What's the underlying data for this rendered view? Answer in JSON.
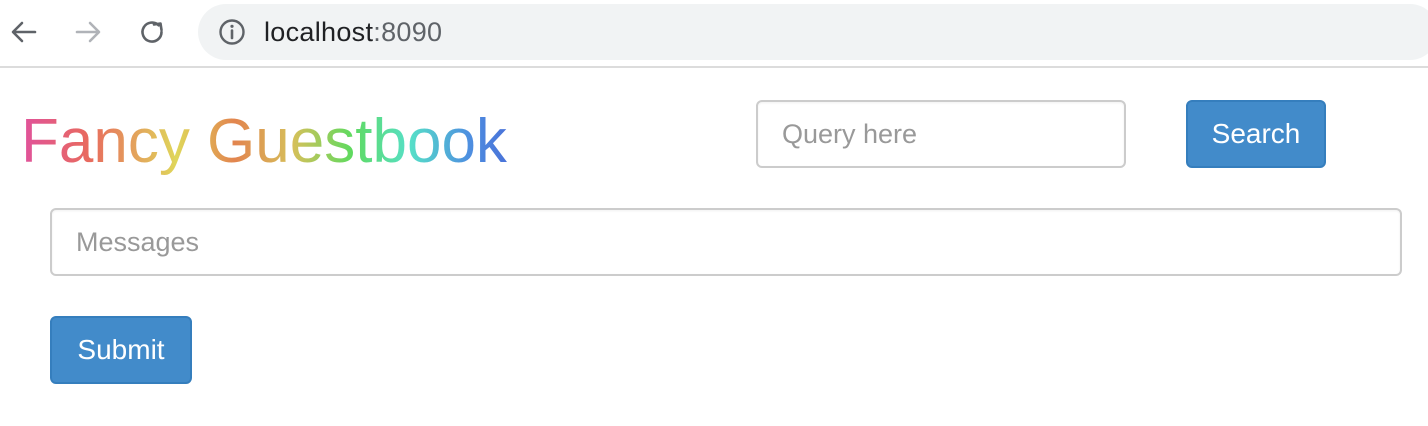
{
  "browser": {
    "url_host": "localhost",
    "url_port": ":8090",
    "icons": {
      "back": "arrow-left-icon",
      "forward": "arrow-right-icon",
      "reload": "reload-icon",
      "info": "info-icon"
    }
  },
  "page": {
    "brand_title": "Fancy Guestbook",
    "search": {
      "placeholder": "Query here",
      "value": "",
      "button_label": "Search"
    },
    "message": {
      "placeholder": "Messages",
      "value": ""
    },
    "submit_label": "Submit"
  },
  "colors": {
    "button_bg": "#428bca",
    "button_border": "#357ebd",
    "input_border": "#cccccc",
    "omnibox_bg": "#f1f3f4"
  }
}
